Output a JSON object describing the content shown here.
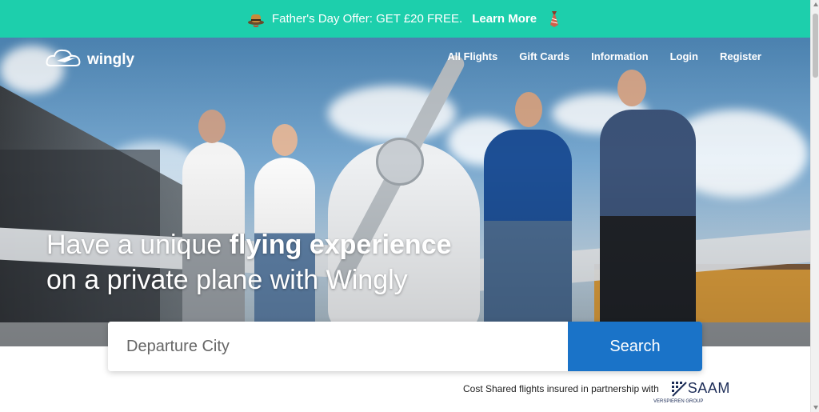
{
  "promo": {
    "text": "Father's Day Offer: GET £20 FREE.",
    "link": "Learn More",
    "left_icon": "hat-icon",
    "right_icon": "tie-icon"
  },
  "header": {
    "logo": "wingly",
    "nav": [
      "All Flights",
      "Gift Cards",
      "Information",
      "Login",
      "Register"
    ]
  },
  "hero": {
    "headline_part1": "Have a unique ",
    "headline_bold": "flying experience",
    "headline_line2": "on a private plane with Wingly"
  },
  "search": {
    "placeholder": "Departure City",
    "button": "Search"
  },
  "insurance": {
    "text": "Cost Shared flights insured in partnership with",
    "partner": "SAAM",
    "partner_sub": "VERSPIEREN GROUP"
  },
  "colors": {
    "promo_bg": "#1dcfac",
    "search_button": "#1a73c8"
  }
}
